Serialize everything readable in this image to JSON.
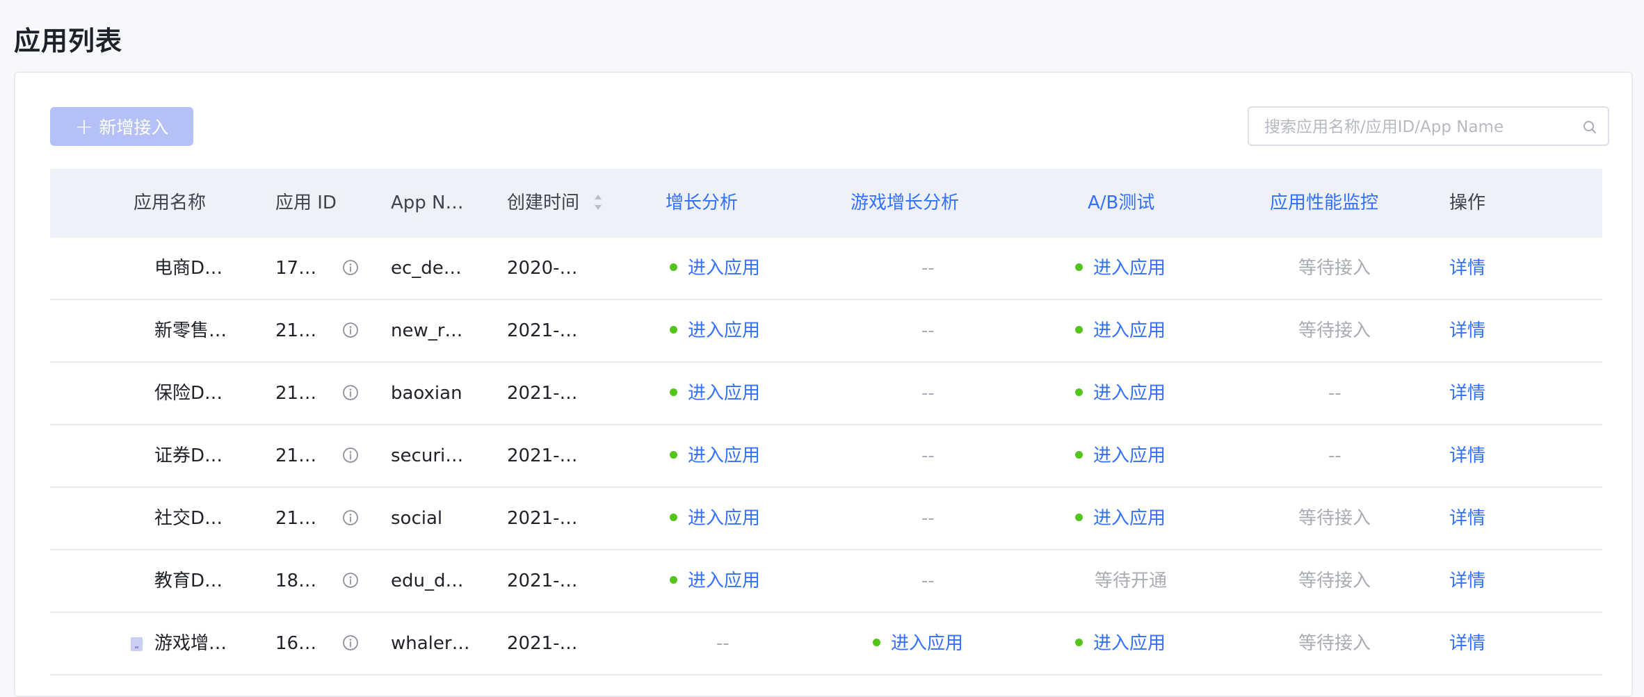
{
  "page": {
    "title": "应用列表"
  },
  "toolbar": {
    "add_button_label": "新增接入",
    "search_placeholder": "搜索应用名称/应用ID/App Name"
  },
  "table": {
    "columns": {
      "app_name": "应用名称",
      "app_id": "应用 ID",
      "app_name_en": "App N…",
      "created": "创建时间",
      "growth": "增长分析",
      "game_growth": "游戏增长分析",
      "ab_test": "A/B测试",
      "apm": "应用性能监控",
      "actions": "操作"
    },
    "rows": [
      {
        "name": "电商D…",
        "id": "17…",
        "app_name": "ec_de…",
        "created": "2020-…",
        "growth": "进入应用",
        "game": "--",
        "ab": "进入应用",
        "apm": "等待接入",
        "action": "详情"
      },
      {
        "name": "新零售…",
        "id": "21…",
        "app_name": "new_r…",
        "created": "2021-…",
        "growth": "进入应用",
        "game": "--",
        "ab": "进入应用",
        "apm": "等待接入",
        "action": "详情"
      },
      {
        "name": "保险D…",
        "id": "21…",
        "app_name": "baoxian",
        "created": "2021-…",
        "growth": "进入应用",
        "game": "--",
        "ab": "进入应用",
        "apm": "--",
        "action": "详情"
      },
      {
        "name": "证券D…",
        "id": "21…",
        "app_name": "securi…",
        "created": "2021-…",
        "growth": "进入应用",
        "game": "--",
        "ab": "进入应用",
        "apm": "--",
        "action": "详情"
      },
      {
        "name": "社交D…",
        "id": "21…",
        "app_name": "social",
        "created": "2021-…",
        "growth": "进入应用",
        "game": "--",
        "ab": "进入应用",
        "apm": "等待接入",
        "action": "详情"
      },
      {
        "name": "教育D…",
        "id": "18…",
        "app_name": "edu_d…",
        "created": "2021-…",
        "growth": "进入应用",
        "game": "--",
        "ab": "等待开通",
        "apm": "等待接入",
        "action": "详情"
      },
      {
        "name": "游戏增…",
        "id": "16…",
        "app_name": "whaler…",
        "created": "2021-…",
        "growth": "--",
        "game": "进入应用",
        "ab": "进入应用",
        "apm": "等待接入",
        "action": "详情"
      }
    ]
  },
  "colors": {
    "accent": "#3370ff",
    "status_dot": "#52c41a",
    "muted": "#a8acb5",
    "button_disabled": "#b5c1f6"
  }
}
